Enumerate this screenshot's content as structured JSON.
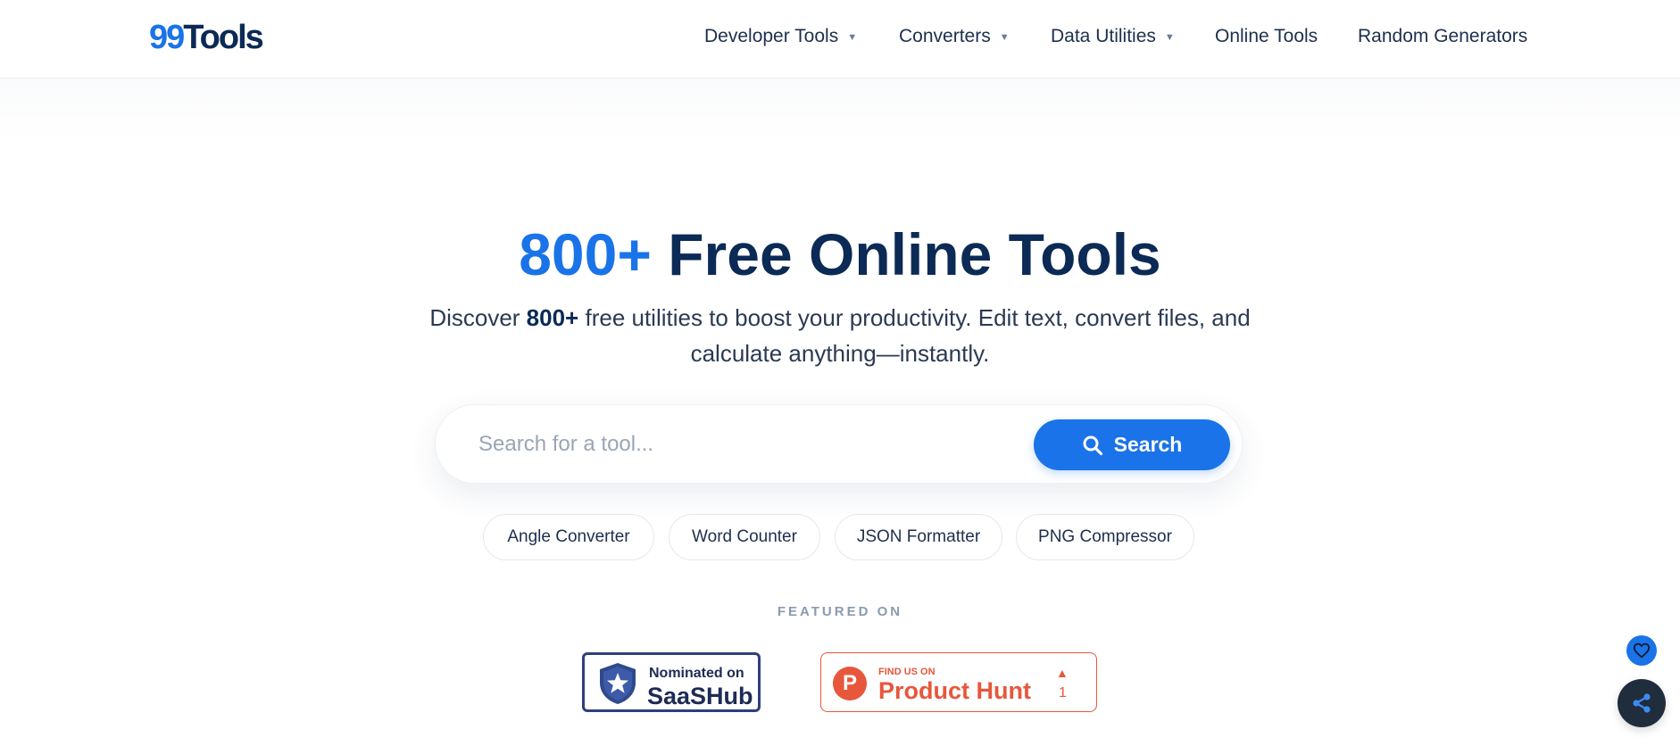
{
  "header": {
    "logo": {
      "number": "99",
      "word": "Tools"
    },
    "nav": [
      {
        "label": "Developer Tools",
        "has_dropdown": true
      },
      {
        "label": "Converters",
        "has_dropdown": true
      },
      {
        "label": "Data Utilities",
        "has_dropdown": true
      },
      {
        "label": "Online Tools",
        "has_dropdown": false
      },
      {
        "label": "Random Generators",
        "has_dropdown": false
      }
    ],
    "dropdown_caret": "▼"
  },
  "hero": {
    "title_accent": "800+",
    "title_rest": "Free Online Tools",
    "subtitle_before": "Discover ",
    "subtitle_bold": "800+",
    "subtitle_after": " free utilities to boost your productivity. Edit text, convert files, and calculate anything—instantly."
  },
  "search": {
    "placeholder": "Search for a tool...",
    "value": "",
    "button_label": "Search",
    "button_icon": "search-icon"
  },
  "quick_links": [
    "Angle Converter",
    "Word Counter",
    "JSON Formatter",
    "PNG Compressor"
  ],
  "featured": {
    "label": "FEATURED ON",
    "saashub": {
      "small": "Nominated on",
      "big": "SaaSHub",
      "icon": "star-shield-icon"
    },
    "product_hunt": {
      "letter": "P",
      "small": "FIND US ON",
      "big": "Product Hunt",
      "arrow": "▲",
      "count": "1"
    }
  },
  "floating": {
    "heart_icon": "heart-icon",
    "share_icon": "share-icon"
  },
  "colors": {
    "accent": "#1a73e8",
    "navy": "#0b2a55",
    "product_hunt": "#e7573b",
    "saashub": "#2f3f7a",
    "share_fab": "#1f2d3d"
  }
}
